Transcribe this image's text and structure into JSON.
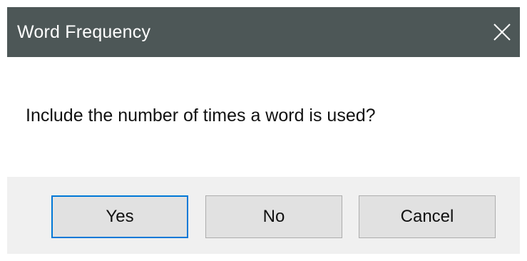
{
  "window": {
    "title": "Word Frequency",
    "close_icon": "close-icon"
  },
  "message": "Include the number of times a word is used?",
  "buttons": {
    "yes": "Yes",
    "no": "No",
    "cancel": "Cancel"
  },
  "colors": {
    "title_bar": "#4d5757",
    "footer": "#f0f0f0",
    "button_face": "#e1e1e1",
    "default_button_border": "#0078d7"
  }
}
